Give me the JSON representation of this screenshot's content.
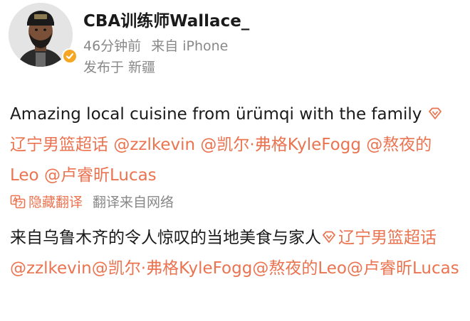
{
  "user": {
    "name": "CBA训练师Wallace_",
    "time": "46分钟前",
    "source": "来自 iPhone",
    "location": "发布于 新疆"
  },
  "post": {
    "text": "Amazing local cuisine  from ürümqi with the family ",
    "mentions": [
      "辽宁男篮超话",
      "@zzlkevin",
      "@凯尔·弗格KyleFogg",
      "@熬夜的Leo",
      "@卢睿昕Lucas"
    ]
  },
  "translate": {
    "hide_label": "隐藏翻译",
    "source_label": "翻译来自网络"
  },
  "translated": {
    "text": "来自乌鲁木齐的令人惊叹的当地美食与家人",
    "mentions": [
      "辽宁男篮超话",
      "@zzlkevin",
      "@凯尔·弗格KyleFogg",
      "@熬夜的Leo",
      "@卢睿昕Lucas"
    ]
  },
  "colors": {
    "link": "#eb7350",
    "meta": "#888888",
    "verified": "#f5a623"
  },
  "icons": [
    "avatar-photo",
    "verified-badge-icon",
    "super-topic-diamond-icon",
    "translate-icon"
  ]
}
